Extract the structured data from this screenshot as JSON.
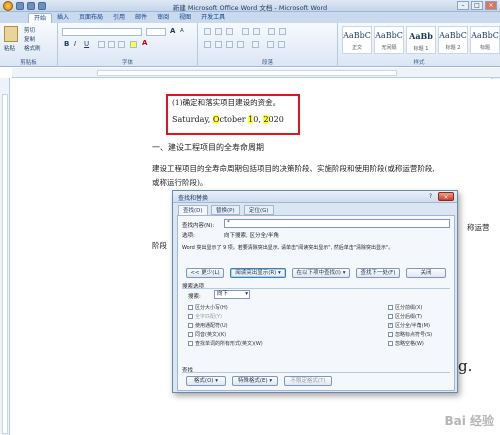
{
  "window": {
    "title": "新建 Microsoft Office Word 文档 - Microsoft Word"
  },
  "ribbon": {
    "tabs": [
      "开始",
      "插入",
      "页面布局",
      "引用",
      "邮件",
      "审阅",
      "视图",
      "开发工具"
    ],
    "active_tab": "开始",
    "clipboard": {
      "paste": "粘贴",
      "cut": "剪切",
      "copy": "复制",
      "format_painter": "格式刷",
      "label": "剪贴板"
    },
    "font": {
      "label": "字体",
      "bold": "B",
      "italic": "I",
      "underline": "U",
      "grow": "A",
      "shrink": "A",
      "font_color": "A"
    },
    "paragraph": {
      "label": "段落"
    },
    "styles": {
      "label": "样式",
      "items": [
        {
          "preview": "AaBbC",
          "name": "正文"
        },
        {
          "preview": "AaBbC",
          "name": "无间隔"
        },
        {
          "preview": "AaBb",
          "name": "标题 1"
        },
        {
          "preview": "AaBbC",
          "name": "标题 2"
        },
        {
          "preview": "AaBbC",
          "name": "标题"
        }
      ]
    }
  },
  "document": {
    "line1": "(1)确定和落实项目建设的资金。",
    "line2_parts": [
      "Saturday, ",
      "O",
      "ctober ",
      "1",
      "0, ",
      "2",
      "020"
    ],
    "heading": "一、建设工程项目的全寿命周期",
    "body1": "建设工程项目的全寿命周期包括项目的决策阶段、实施阶段和使用阶段(或称运营阶段,",
    "body2": "或称运行阶段)。",
    "frag_right": "称运营",
    "frag_left": "阶段",
    "frag_big": "g."
  },
  "dialog": {
    "title": "查找和替换",
    "help": "?",
    "close": "×",
    "tabs": [
      "查找(D)",
      "替换(P)",
      "定位(G)"
    ],
    "find_label": "查找内容(N):",
    "find_value": "*",
    "options_label": "选项:",
    "options_value": "向下搜索, 区分全/半角",
    "message": "Word 突出显示了 9 项。若要清除突出显示, 请单击\"阅读突出显示\", 然后单击\"清除突出显示\"。",
    "buttons": {
      "less": "<< 更少(L)",
      "reading_highlight": "阅读突出显示(R) ▾",
      "find_in": "在以下项中查找(I) ▾",
      "find_next": "查找下一处(F)",
      "close": "关闭"
    },
    "search_options_label": "搜索选项",
    "search_label": "搜索:",
    "search_value": "向下",
    "checkboxes_left": [
      {
        "label": "区分大小写(H)",
        "checked": false,
        "enabled": true
      },
      {
        "label": "全字匹配(Y)",
        "checked": false,
        "enabled": false
      },
      {
        "label": "使用通配符(U)",
        "checked": false,
        "enabled": true
      },
      {
        "label": "同音(英文)(K)",
        "checked": false,
        "enabled": true
      },
      {
        "label": "查找单词的所有形式(英文)(W)",
        "checked": false,
        "enabled": true
      }
    ],
    "checkboxes_right": [
      {
        "label": "区分前缀(X)",
        "checked": false,
        "enabled": true
      },
      {
        "label": "区分后缀(T)",
        "checked": false,
        "enabled": true
      },
      {
        "label": "区分全/半角(M)",
        "checked": true,
        "enabled": true
      },
      {
        "label": "忽略标点符号(S)",
        "checked": false,
        "enabled": true
      },
      {
        "label": "忽略空格(W)",
        "checked": false,
        "enabled": true
      }
    ],
    "find_section_label": "查找",
    "bottom_buttons": {
      "format": "格式(O) ▾",
      "special": "特殊格式(E) ▾",
      "no_format": "不限定格式(T)"
    }
  },
  "watermark": "Bai 经验"
}
